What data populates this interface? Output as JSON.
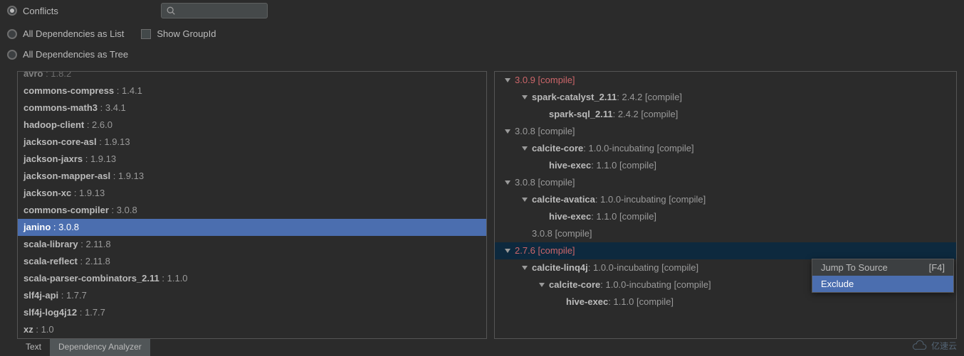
{
  "options": {
    "conflicts_label": "Conflicts",
    "all_list_label": "All Dependencies as List",
    "all_tree_label": "All Dependencies as Tree",
    "show_groupid_label": "Show GroupId"
  },
  "left_deps": [
    {
      "name": "avro",
      "ver": ": 1.8.2",
      "partial": true
    },
    {
      "name": "commons-compress",
      "ver": ": 1.4.1"
    },
    {
      "name": "commons-math3",
      "ver": ": 3.4.1"
    },
    {
      "name": "hadoop-client",
      "ver": ": 2.6.0"
    },
    {
      "name": "jackson-core-asl",
      "ver": ": 1.9.13"
    },
    {
      "name": "jackson-jaxrs",
      "ver": ": 1.9.13"
    },
    {
      "name": "jackson-mapper-asl",
      "ver": ": 1.9.13"
    },
    {
      "name": "jackson-xc",
      "ver": ": 1.9.13"
    },
    {
      "name": "commons-compiler",
      "ver": ": 3.0.8"
    },
    {
      "name": "janino",
      "ver": ": 3.0.8",
      "selected": true
    },
    {
      "name": "scala-library",
      "ver": ": 2.11.8"
    },
    {
      "name": "scala-reflect",
      "ver": ": 2.11.8"
    },
    {
      "name": "scala-parser-combinators_2.11",
      "ver": ": 1.1.0"
    },
    {
      "name": "slf4j-api",
      "ver": ": 1.7.7"
    },
    {
      "name": "slf4j-log4j12",
      "ver": ": 1.7.7"
    },
    {
      "name": "xz",
      "ver": ": 1.0"
    }
  ],
  "right_tree": [
    {
      "depth": 0,
      "tri": true,
      "name": "",
      "ver": "3.0.9 [compile]",
      "red": true
    },
    {
      "depth": 1,
      "tri": true,
      "name": "spark-catalyst_2.11",
      "ver": ": 2.4.2 [compile]"
    },
    {
      "depth": 2,
      "tri": false,
      "name": "spark-sql_2.11",
      "ver": ": 2.4.2 [compile]"
    },
    {
      "depth": 0,
      "tri": true,
      "name": "",
      "ver": "3.0.8 [compile]"
    },
    {
      "depth": 1,
      "tri": true,
      "name": "calcite-core",
      "ver": ": 1.0.0-incubating [compile]"
    },
    {
      "depth": 2,
      "tri": false,
      "name": "hive-exec",
      "ver": ": 1.1.0 [compile]"
    },
    {
      "depth": 0,
      "tri": true,
      "name": "",
      "ver": "3.0.8 [compile]"
    },
    {
      "depth": 1,
      "tri": true,
      "name": "calcite-avatica",
      "ver": ": 1.0.0-incubating [compile]"
    },
    {
      "depth": 2,
      "tri": false,
      "name": "hive-exec",
      "ver": ": 1.1.0 [compile]"
    },
    {
      "depth": 1,
      "tri": false,
      "name": "",
      "ver": "3.0.8 [compile]"
    },
    {
      "depth": 0,
      "tri": true,
      "name": "",
      "ver": "2.7.6 [compile]",
      "red": true,
      "selected": true
    },
    {
      "depth": 1,
      "tri": true,
      "name": "calcite-linq4j",
      "ver": ": 1.0.0-incubating [compile]"
    },
    {
      "depth": 2,
      "tri": true,
      "name": "calcite-core",
      "ver": ": 1.0.0-incubating [compile]"
    },
    {
      "depth": 3,
      "tri": false,
      "name": "hive-exec",
      "ver": ": 1.1.0 [compile]"
    }
  ],
  "tabs": {
    "text_label": "Text",
    "analyzer_label": "Dependency Analyzer"
  },
  "context_menu": {
    "jump_label": "Jump To Source",
    "jump_shortcut": "[F4]",
    "exclude_label": "Exclude"
  },
  "watermark": "亿速云"
}
